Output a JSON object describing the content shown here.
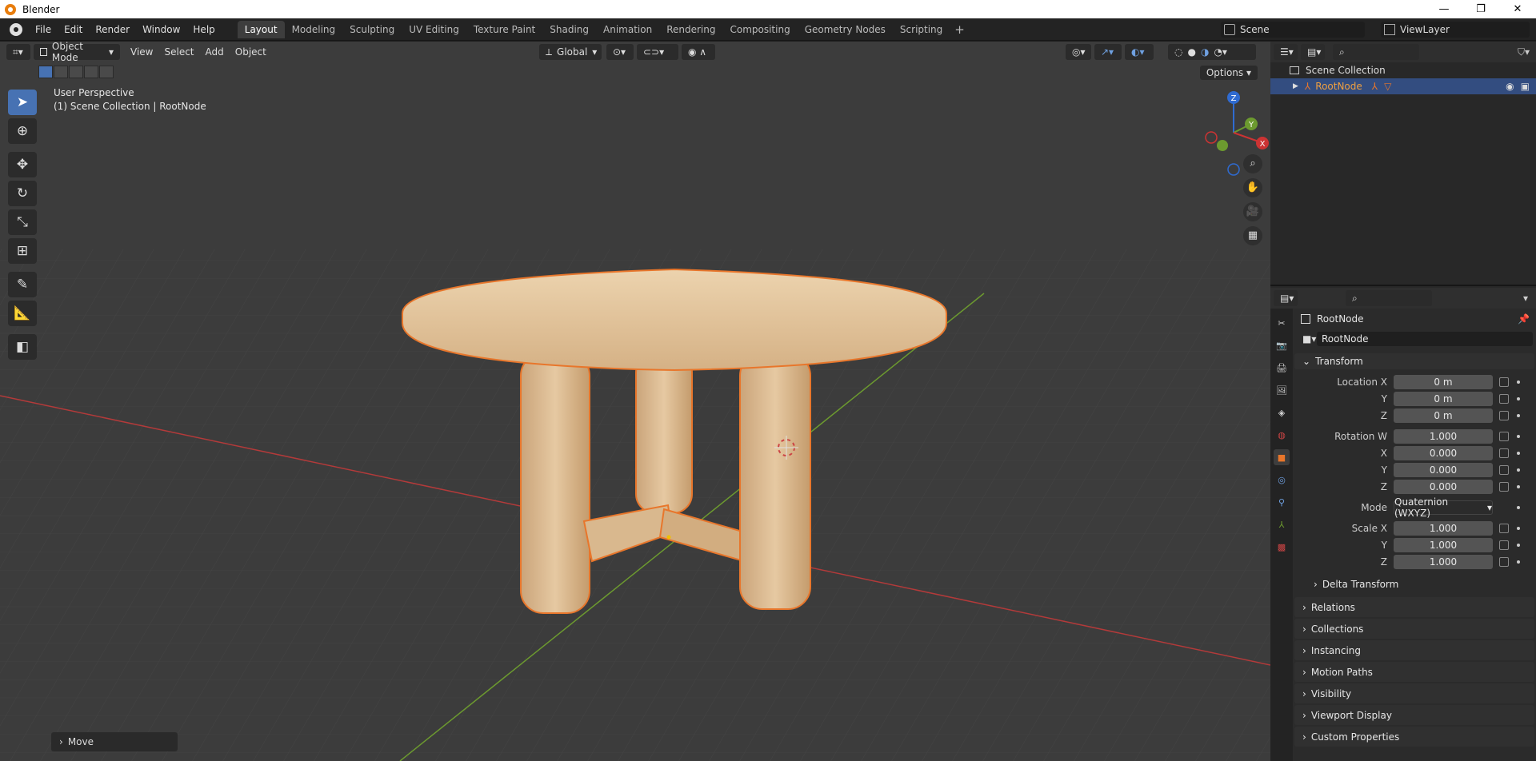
{
  "window": {
    "title": "Blender",
    "controls": [
      "—",
      "❐",
      "✕"
    ]
  },
  "menu": [
    "File",
    "Edit",
    "Render",
    "Window",
    "Help"
  ],
  "workspaces": [
    "Layout",
    "Modeling",
    "Sculpting",
    "UV Editing",
    "Texture Paint",
    "Shading",
    "Animation",
    "Rendering",
    "Compositing",
    "Geometry Nodes",
    "Scripting"
  ],
  "active_workspace": "Layout",
  "scene": "Scene",
  "view_layer": "ViewLayer",
  "viewport": {
    "mode": "Object Mode",
    "menus": [
      "View",
      "Select",
      "Add",
      "Object"
    ],
    "orientation": "Global",
    "options": "Options",
    "perspective": "User Perspective",
    "context": "(1) Scene Collection | RootNode",
    "last_op": "Move"
  },
  "gizmo": {
    "x": "X",
    "y": "Y",
    "z": "Z"
  },
  "outliner": {
    "collection": "Scene Collection",
    "item": "RootNode"
  },
  "properties": {
    "object_name": "RootNode",
    "data_name": "RootNode",
    "transform": {
      "title": "Transform",
      "location": [
        {
          "label": "Location X",
          "value": "0 m"
        },
        {
          "label": "Y",
          "value": "0 m"
        },
        {
          "label": "Z",
          "value": "0 m"
        }
      ],
      "rotation": [
        {
          "label": "Rotation W",
          "value": "1.000"
        },
        {
          "label": "X",
          "value": "0.000"
        },
        {
          "label": "Y",
          "value": "0.000"
        },
        {
          "label": "Z",
          "value": "0.000"
        }
      ],
      "mode_label": "Mode",
      "mode_value": "Quaternion (WXYZ)",
      "scale": [
        {
          "label": "Scale X",
          "value": "1.000"
        },
        {
          "label": "Y",
          "value": "1.000"
        },
        {
          "label": "Z",
          "value": "1.000"
        }
      ],
      "delta": "Delta Transform"
    },
    "sections": [
      "Relations",
      "Collections",
      "Instancing",
      "Motion Paths",
      "Visibility",
      "Viewport Display",
      "Custom Properties"
    ]
  },
  "colors": {
    "accent": "#4772b3",
    "selection_outline": "#e8762b",
    "x_axis": "#b33a3a",
    "y_axis": "#6c9a2f"
  }
}
